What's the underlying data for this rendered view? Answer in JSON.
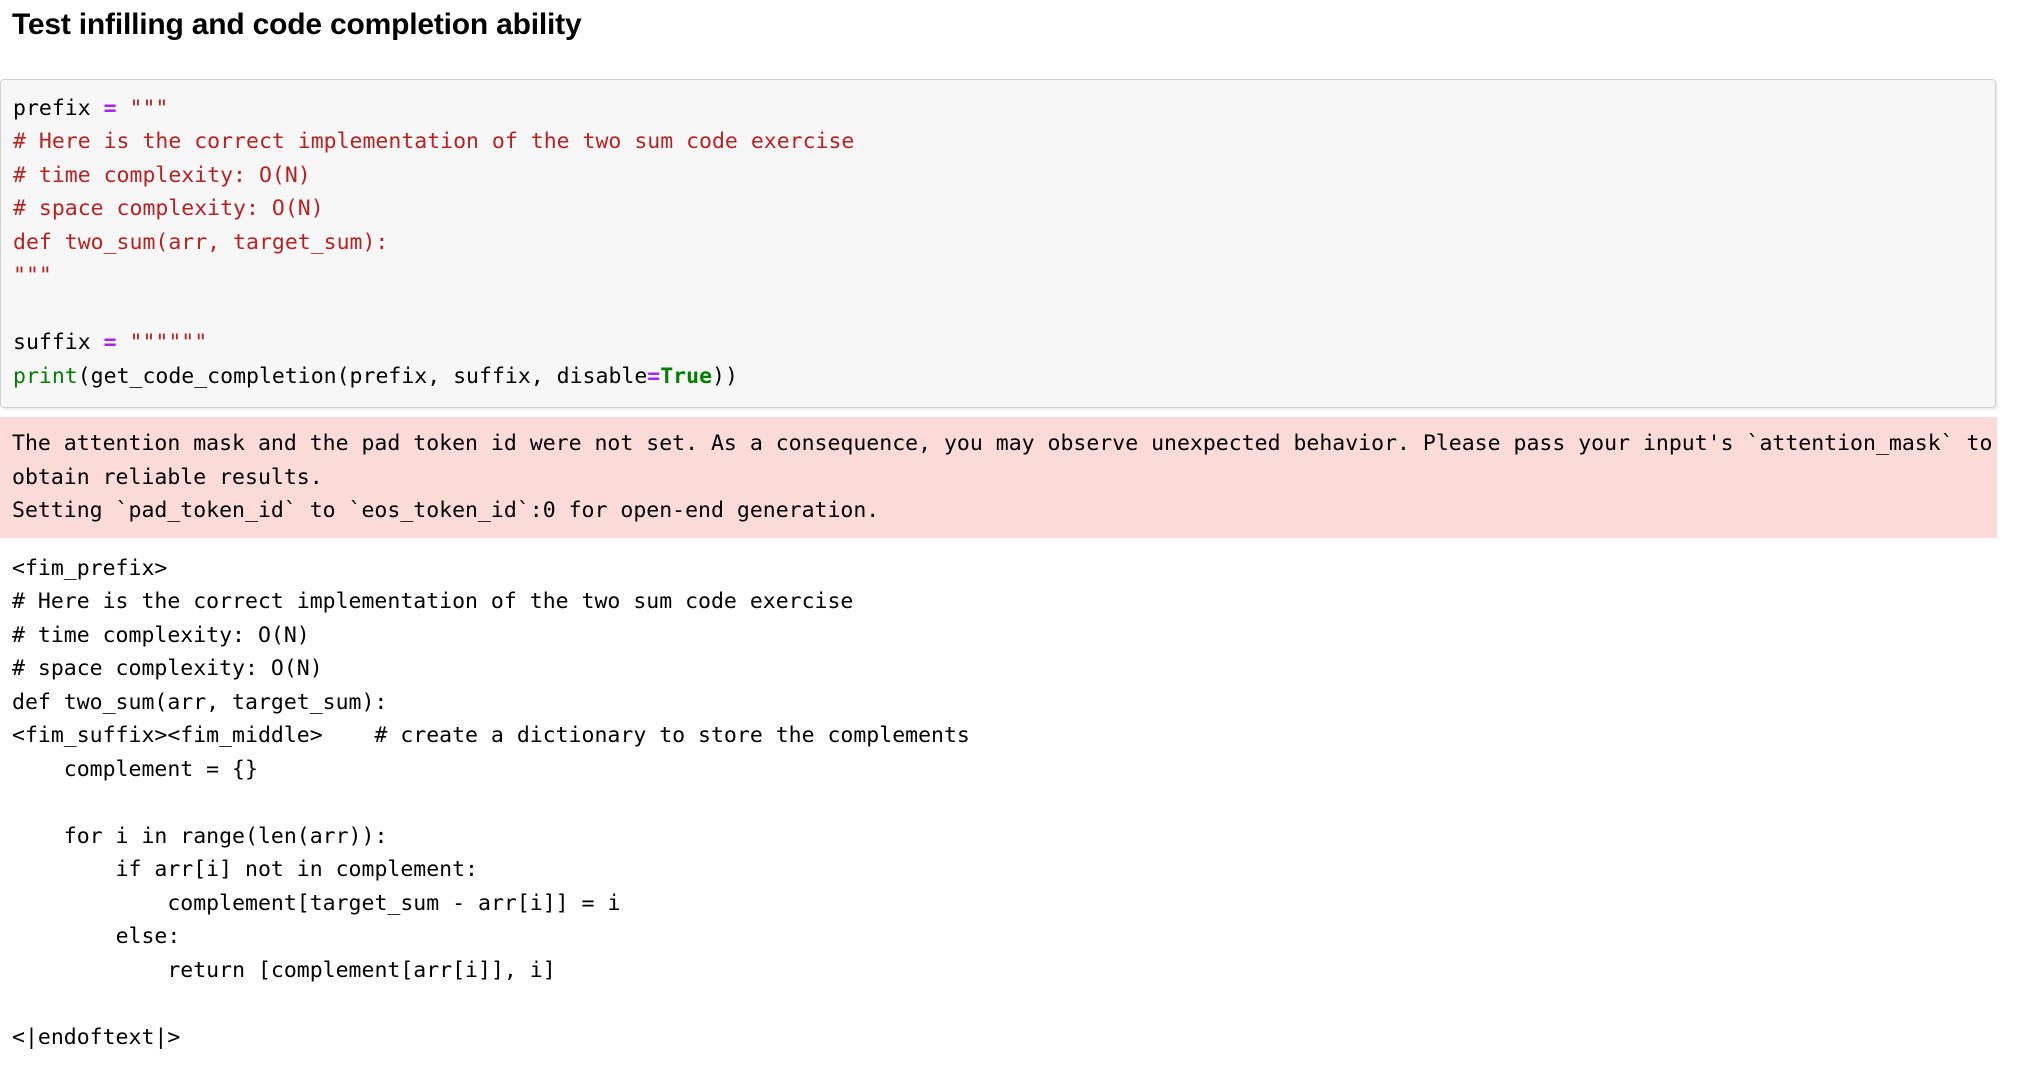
{
  "heading": {
    "title": "Test infilling and code completion ability"
  },
  "code_cell": {
    "language": "python",
    "lines": [
      {
        "segments": [
          {
            "text": "prefix ",
            "token": "plain"
          },
          {
            "text": "=",
            "token": "operator"
          },
          {
            "text": " ",
            "token": "plain"
          },
          {
            "text": "\"\"\"",
            "token": "string"
          }
        ]
      },
      {
        "segments": [
          {
            "text": "# Here is the correct implementation of the two sum code exercise",
            "token": "string"
          }
        ]
      },
      {
        "segments": [
          {
            "text": "# time complexity: O(N)",
            "token": "string"
          }
        ]
      },
      {
        "segments": [
          {
            "text": "# space complexity: O(N)",
            "token": "string"
          }
        ]
      },
      {
        "segments": [
          {
            "text": "def two_sum(arr, target_sum):",
            "token": "string"
          }
        ]
      },
      {
        "segments": [
          {
            "text": "\"\"\"",
            "token": "string"
          }
        ]
      },
      {
        "segments": [
          {
            "text": "",
            "token": "plain"
          }
        ]
      },
      {
        "segments": [
          {
            "text": "suffix ",
            "token": "plain"
          },
          {
            "text": "=",
            "token": "operator"
          },
          {
            "text": " ",
            "token": "plain"
          },
          {
            "text": "\"\"\"\"\"\"",
            "token": "string"
          }
        ]
      },
      {
        "segments": [
          {
            "text": "print",
            "token": "function"
          },
          {
            "text": "(get_code_completion(prefix, suffix, disable",
            "token": "plain"
          },
          {
            "text": "=",
            "token": "operator"
          },
          {
            "text": "True",
            "token": "keyword-constant"
          },
          {
            "text": "))",
            "token": "plain"
          }
        ]
      }
    ]
  },
  "stderr_output": {
    "stream": "stderr",
    "background_color": "#fadbd8",
    "text": "The attention mask and the pad token id were not set. As a consequence, you may observe unexpected behavior. Please pass your input's `attention_mask` to obtain reliable results.\nSetting `pad_token_id` to `eos_token_id`:0 for open-end generation."
  },
  "stdout_output": {
    "stream": "stdout",
    "text": "<fim_prefix>\n# Here is the correct implementation of the two sum code exercise\n# time complexity: O(N)\n# space complexity: O(N)\ndef two_sum(arr, target_sum):\n<fim_suffix><fim_middle>    # create a dictionary to store the complements\n    complement = {}\n\n    for i in range(len(arr)):\n        if arr[i] not in complement:\n            complement[target_sum - arr[i]] = i\n        else:\n            return [complement[arr[i]], i]\n\n<|endoftext|>"
  },
  "colors": {
    "code_cell_background": "#f7f7f7",
    "code_cell_border": "#cfcfcf",
    "stderr_background": "#fadbd8",
    "operator": "#aa22ff",
    "string": "#ba2121",
    "function": "#008000",
    "keyword_constant": "#008000",
    "text": "#000000",
    "page_background": "#ffffff"
  }
}
